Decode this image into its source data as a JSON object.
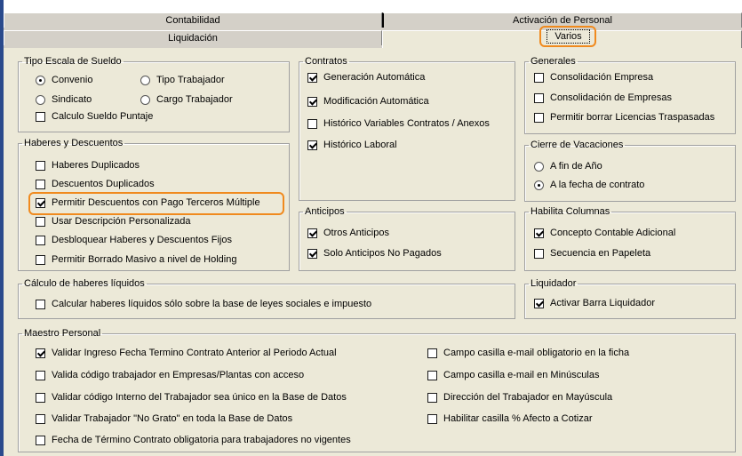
{
  "tabs": {
    "row1": [
      "Contabilidad",
      "Activación de Personal"
    ],
    "row2": [
      "Liquidación",
      "Varios"
    ],
    "active": "Varios"
  },
  "accent_color": "#f08a1e",
  "groups": {
    "tipo_escala": {
      "title": "Tipo Escala de Sueldo",
      "radios": [
        {
          "label": "Convenio",
          "checked": true
        },
        {
          "label": "Tipo Trabajador",
          "checked": false
        },
        {
          "label": "Sindicato",
          "checked": false
        },
        {
          "label": "Cargo Trabajador",
          "checked": false
        }
      ],
      "checkbox": {
        "label": "Calculo Sueldo Puntaje",
        "checked": false
      }
    },
    "haberes": {
      "title": "Haberes y Descuentos",
      "items": [
        {
          "label": "Haberes Duplicados",
          "checked": false
        },
        {
          "label": "Descuentos Duplicados",
          "checked": false
        },
        {
          "label": "Permitir Descuentos con Pago Terceros Múltiple",
          "checked": true
        },
        {
          "label": "Usar Descripción Personalizada",
          "checked": false
        },
        {
          "label": "Desbloquear Haberes y Descuentos Fijos",
          "checked": false
        },
        {
          "label": "Permitir Borrado Masivo a nivel de Holding",
          "checked": false
        }
      ]
    },
    "contratos": {
      "title": "Contratos",
      "items": [
        {
          "label": "Generación Automática",
          "checked": true
        },
        {
          "label": "Modificación Automática",
          "checked": true
        },
        {
          "label": "Histórico Variables Contratos / Anexos",
          "checked": false
        },
        {
          "label": "Histórico Laboral",
          "checked": true
        }
      ]
    },
    "anticipos": {
      "title": "Anticipos",
      "items": [
        {
          "label": "Otros Anticipos",
          "checked": true
        },
        {
          "label": "Solo Anticipos No Pagados",
          "checked": true
        }
      ]
    },
    "generales": {
      "title": "Generales",
      "items": [
        {
          "label": "Consolidación Empresa",
          "checked": false
        },
        {
          "label": "Consolidación de Empresas",
          "checked": false
        },
        {
          "label": "Permitir borrar Licencias Traspasadas",
          "checked": false
        }
      ]
    },
    "cierre": {
      "title": "Cierre de Vacaciones",
      "radios": [
        {
          "label": "A fin de Año",
          "checked": false
        },
        {
          "label": "A la fecha de contrato",
          "checked": true
        }
      ]
    },
    "columnas": {
      "title": "Habilita Columnas",
      "items": [
        {
          "label": "Concepto Contable Adicional",
          "checked": true
        },
        {
          "label": "Secuencia en Papeleta",
          "checked": false
        }
      ]
    },
    "calculo": {
      "title": "Cálculo de haberes líquidos",
      "items": [
        {
          "label": "Calcular haberes líquidos sólo sobre la base de leyes sociales e impuesto",
          "checked": false
        }
      ]
    },
    "liquidador": {
      "title": "Liquidador",
      "items": [
        {
          "label": "Activar Barra Liquidador",
          "checked": true
        }
      ]
    },
    "maestro": {
      "title": "Maestro Personal",
      "left": [
        {
          "label": "Validar Ingreso Fecha Termino Contrato Anterior al Periodo Actual",
          "checked": true
        },
        {
          "label": "Valida código trabajador en Empresas/Plantas con acceso",
          "checked": false
        },
        {
          "label": "Validar código Interno del Trabajador sea único en la Base de Datos",
          "checked": false
        },
        {
          "label": "Validar Trabajador \"No Grato\" en toda la Base de Datos",
          "checked": false
        },
        {
          "label": "Fecha de Término Contrato obligatoria para trabajadores no vigentes",
          "checked": false
        }
      ],
      "right": [
        {
          "label": "Campo casilla e-mail obligatorio en la ficha",
          "checked": false
        },
        {
          "label": "Campo casilla e-mail en Minúsculas",
          "checked": false
        },
        {
          "label": "Dirección del Trabajador en Mayúscula",
          "checked": false
        },
        {
          "label": "Habilitar casilla % Afecto a Cotizar",
          "checked": false
        }
      ]
    }
  }
}
